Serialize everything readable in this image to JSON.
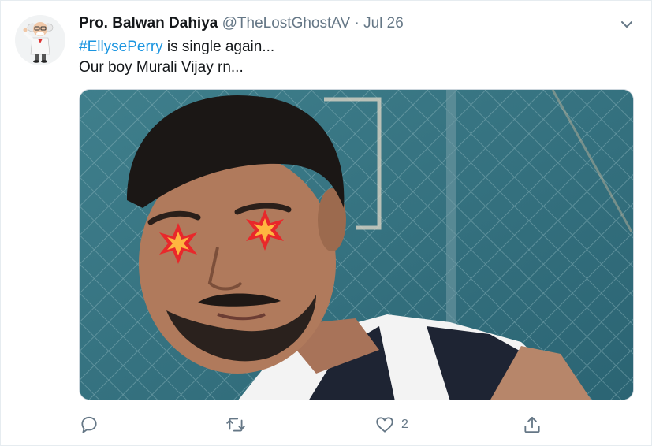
{
  "tweet": {
    "display_name": "Pro. Balwan Dahiya",
    "handle": "@TheLostGhostAV",
    "separator": "·",
    "date": "Jul 26",
    "hashtag": "#EllysePerry",
    "text_line1_rest": " is single again...",
    "text_line2": "Our boy Murali Vijay rn..."
  },
  "actions": {
    "reply_count": "",
    "retweet_count": "",
    "like_count": "2"
  },
  "icons": {
    "avatar": "cartoon-professor-avatar",
    "chevron": "chevron-down-icon",
    "reply": "reply-icon",
    "retweet": "retweet-icon",
    "like": "heart-icon",
    "share": "share-icon"
  },
  "colors": {
    "link": "#1b95e0",
    "text": "#14171a",
    "secondary": "#657786"
  }
}
